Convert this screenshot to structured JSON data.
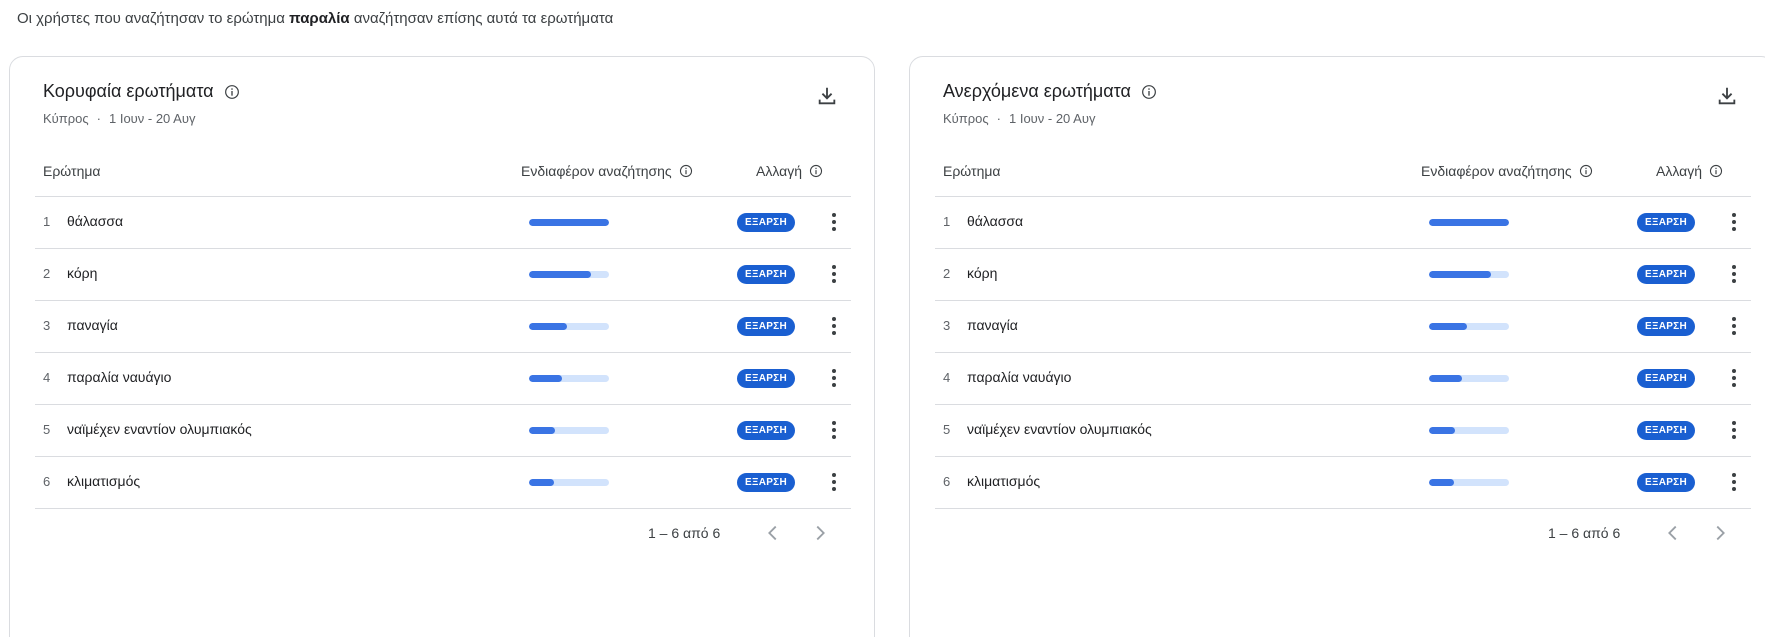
{
  "intro": {
    "before": "Οι χρήστες που αναζήτησαν το ερώτημα",
    "term": "παραλία",
    "after": "αναζήτησαν επίσης αυτά τα ερωτήματα"
  },
  "colors": {
    "bar_fill": "#3a74e4",
    "bar_track": "#d2e3fc",
    "badge": "#1a5fd1"
  },
  "icons": {
    "info": "info-icon",
    "download": "download-icon",
    "row_menu": "more-vert-icon",
    "prev": "chevron-left-icon",
    "next": "chevron-right-icon"
  },
  "panels": [
    {
      "title": "Κορυφαία ερωτήματα",
      "region": "Κύπρος",
      "separator": "·",
      "period": "1 Ιουν - 20 Αυγ",
      "columns": {
        "query": "Ερώτημα",
        "interest": "Ενδιαφέρον αναζήτησης",
        "change": "Αλλαγή"
      },
      "rows": [
        {
          "rank": "1",
          "query": "θάλασσα",
          "interest": 100,
          "badge": "ΕΞΑΡΣΗ"
        },
        {
          "rank": "2",
          "query": "κόρη",
          "interest": 78,
          "badge": "ΕΞΑΡΣΗ"
        },
        {
          "rank": "3",
          "query": "παναγία",
          "interest": 48,
          "badge": "ΕΞΑΡΣΗ"
        },
        {
          "rank": "4",
          "query": "παραλία ναυάγιο",
          "interest": 41,
          "badge": "ΕΞΑΡΣΗ"
        },
        {
          "rank": "5",
          "query": "ναϊμέχεν εναντίον ολυμπιακός",
          "interest": 33,
          "badge": "ΕΞΑΡΣΗ"
        },
        {
          "rank": "6",
          "query": "κλιματισμός",
          "interest": 31,
          "badge": "ΕΞΑΡΣΗ"
        }
      ],
      "pagination": "1 – 6 από 6"
    },
    {
      "title": "Ανερχόμενα ερωτήματα",
      "region": "Κύπρος",
      "separator": "·",
      "period": "1 Ιουν - 20 Αυγ",
      "columns": {
        "query": "Ερώτημα",
        "interest": "Ενδιαφέρον αναζήτησης",
        "change": "Αλλαγή"
      },
      "rows": [
        {
          "rank": "1",
          "query": "θάλασσα",
          "interest": 100,
          "badge": "ΕΞΑΡΣΗ"
        },
        {
          "rank": "2",
          "query": "κόρη",
          "interest": 78,
          "badge": "ΕΞΑΡΣΗ"
        },
        {
          "rank": "3",
          "query": "παναγία",
          "interest": 48,
          "badge": "ΕΞΑΡΣΗ"
        },
        {
          "rank": "4",
          "query": "παραλία ναυάγιο",
          "interest": 41,
          "badge": "ΕΞΑΡΣΗ"
        },
        {
          "rank": "5",
          "query": "ναϊμέχεν εναντίον ολυμπιακός",
          "interest": 33,
          "badge": "ΕΞΑΡΣΗ"
        },
        {
          "rank": "6",
          "query": "κλιματισμός",
          "interest": 31,
          "badge": "ΕΞΑΡΣΗ"
        }
      ],
      "pagination": "1 – 6 από 6"
    }
  ]
}
